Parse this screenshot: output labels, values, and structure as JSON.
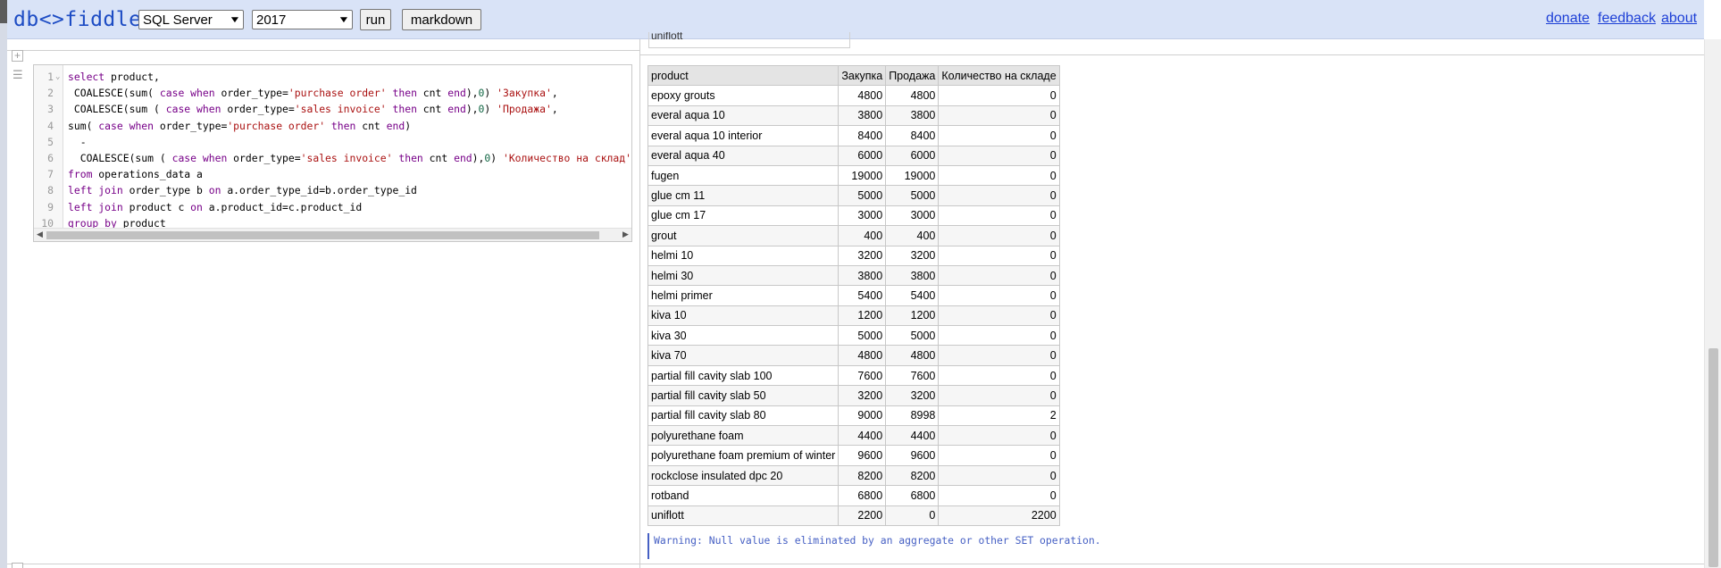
{
  "header": {
    "logo": "db<>fiddle",
    "engine": "SQL Server",
    "version": "2017",
    "run_label": "run",
    "markdown_label": "markdown",
    "links": [
      "donate",
      "feedback",
      "about"
    ]
  },
  "editor": {
    "lines": [
      {
        "n": "1",
        "html": "<span class=\"kw\">select</span> product,"
      },
      {
        "n": "2",
        "html": " COALESCE(sum( <span class=\"kw\">case</span> <span class=\"kw\">when</span> order_type=<span class=\"str\">'purchase order'</span> <span class=\"kw\">then</span> cnt <span class=\"kw\">end</span>),<span class=\"num\">0</span>) <span class=\"str\">'Закупка'</span>,"
      },
      {
        "n": "3",
        "html": " COALESCE(sum ( <span class=\"kw\">case</span> <span class=\"kw\">when</span> order_type=<span class=\"str\">'sales invoice'</span> <span class=\"kw\">then</span> cnt <span class=\"kw\">end</span>),<span class=\"num\">0</span>) <span class=\"str\">'Продажа'</span>,"
      },
      {
        "n": "4",
        "html": "sum( <span class=\"kw\">case</span> <span class=\"kw\">when</span> order_type=<span class=\"str\">'purchase order'</span> <span class=\"kw\">then</span> cnt <span class=\"kw\">end</span>)"
      },
      {
        "n": "5",
        "html": "  -"
      },
      {
        "n": "6",
        "html": "  COALESCE(sum ( <span class=\"kw\">case</span> <span class=\"kw\">when</span> order_type=<span class=\"str\">'sales invoice'</span> <span class=\"kw\">then</span> cnt <span class=\"kw\">end</span>),<span class=\"num\">0</span>) <span class=\"str\">'Количество на склад'</span>"
      },
      {
        "n": "7",
        "html": "<span class=\"kw\">from</span> operations_data a"
      },
      {
        "n": "8",
        "html": "<span class=\"kw\">left</span> <span class=\"kw\">join</span> order_type b <span class=\"kw\">on</span> a.order_type_id=b.order_type_id"
      },
      {
        "n": "9",
        "html": "<span class=\"kw\">left</span> <span class=\"kw\">join</span> product c <span class=\"kw\">on</span> a.product_id=c.product_id"
      },
      {
        "n": "10",
        "html": "<span class=\"kw\">group</span> <span class=\"kw\">by</span> product"
      }
    ]
  },
  "previous_output_fragment": "uniflott",
  "results": {
    "columns": [
      "product",
      "Закупка",
      "Продажа",
      "Количество на складе"
    ],
    "rows": [
      [
        "epoxy grouts",
        "4800",
        "4800",
        "0"
      ],
      [
        "everal aqua 10",
        "3800",
        "3800",
        "0"
      ],
      [
        "everal aqua 10 interior",
        "8400",
        "8400",
        "0"
      ],
      [
        "everal aqua 40",
        "6000",
        "6000",
        "0"
      ],
      [
        "fugen",
        "19000",
        "19000",
        "0"
      ],
      [
        "glue cm 11",
        "5000",
        "5000",
        "0"
      ],
      [
        "glue cm 17",
        "3000",
        "3000",
        "0"
      ],
      [
        "grout",
        "400",
        "400",
        "0"
      ],
      [
        "helmi 10",
        "3200",
        "3200",
        "0"
      ],
      [
        "helmi 30",
        "3800",
        "3800",
        "0"
      ],
      [
        "helmi primer",
        "5400",
        "5400",
        "0"
      ],
      [
        "kiva 10",
        "1200",
        "1200",
        "0"
      ],
      [
        "kiva 30",
        "5000",
        "5000",
        "0"
      ],
      [
        "kiva 70",
        "4800",
        "4800",
        "0"
      ],
      [
        "partial fill cavity slab 100",
        "7600",
        "7600",
        "0"
      ],
      [
        "partial fill cavity slab 50",
        "3200",
        "3200",
        "0"
      ],
      [
        "partial fill cavity slab 80",
        "9000",
        "8998",
        "2"
      ],
      [
        "polyurethane foam",
        "4400",
        "4400",
        "0"
      ],
      [
        "polyurethane foam premium of winter",
        "9600",
        "9600",
        "0"
      ],
      [
        "rockclose insulated dpc 20",
        "8200",
        "8200",
        "0"
      ],
      [
        "rotband",
        "6800",
        "6800",
        "0"
      ],
      [
        "uniflott",
        "2200",
        "0",
        "2200"
      ]
    ]
  },
  "warning": "Warning: Null value is eliminated by an aggregate or other SET operation."
}
